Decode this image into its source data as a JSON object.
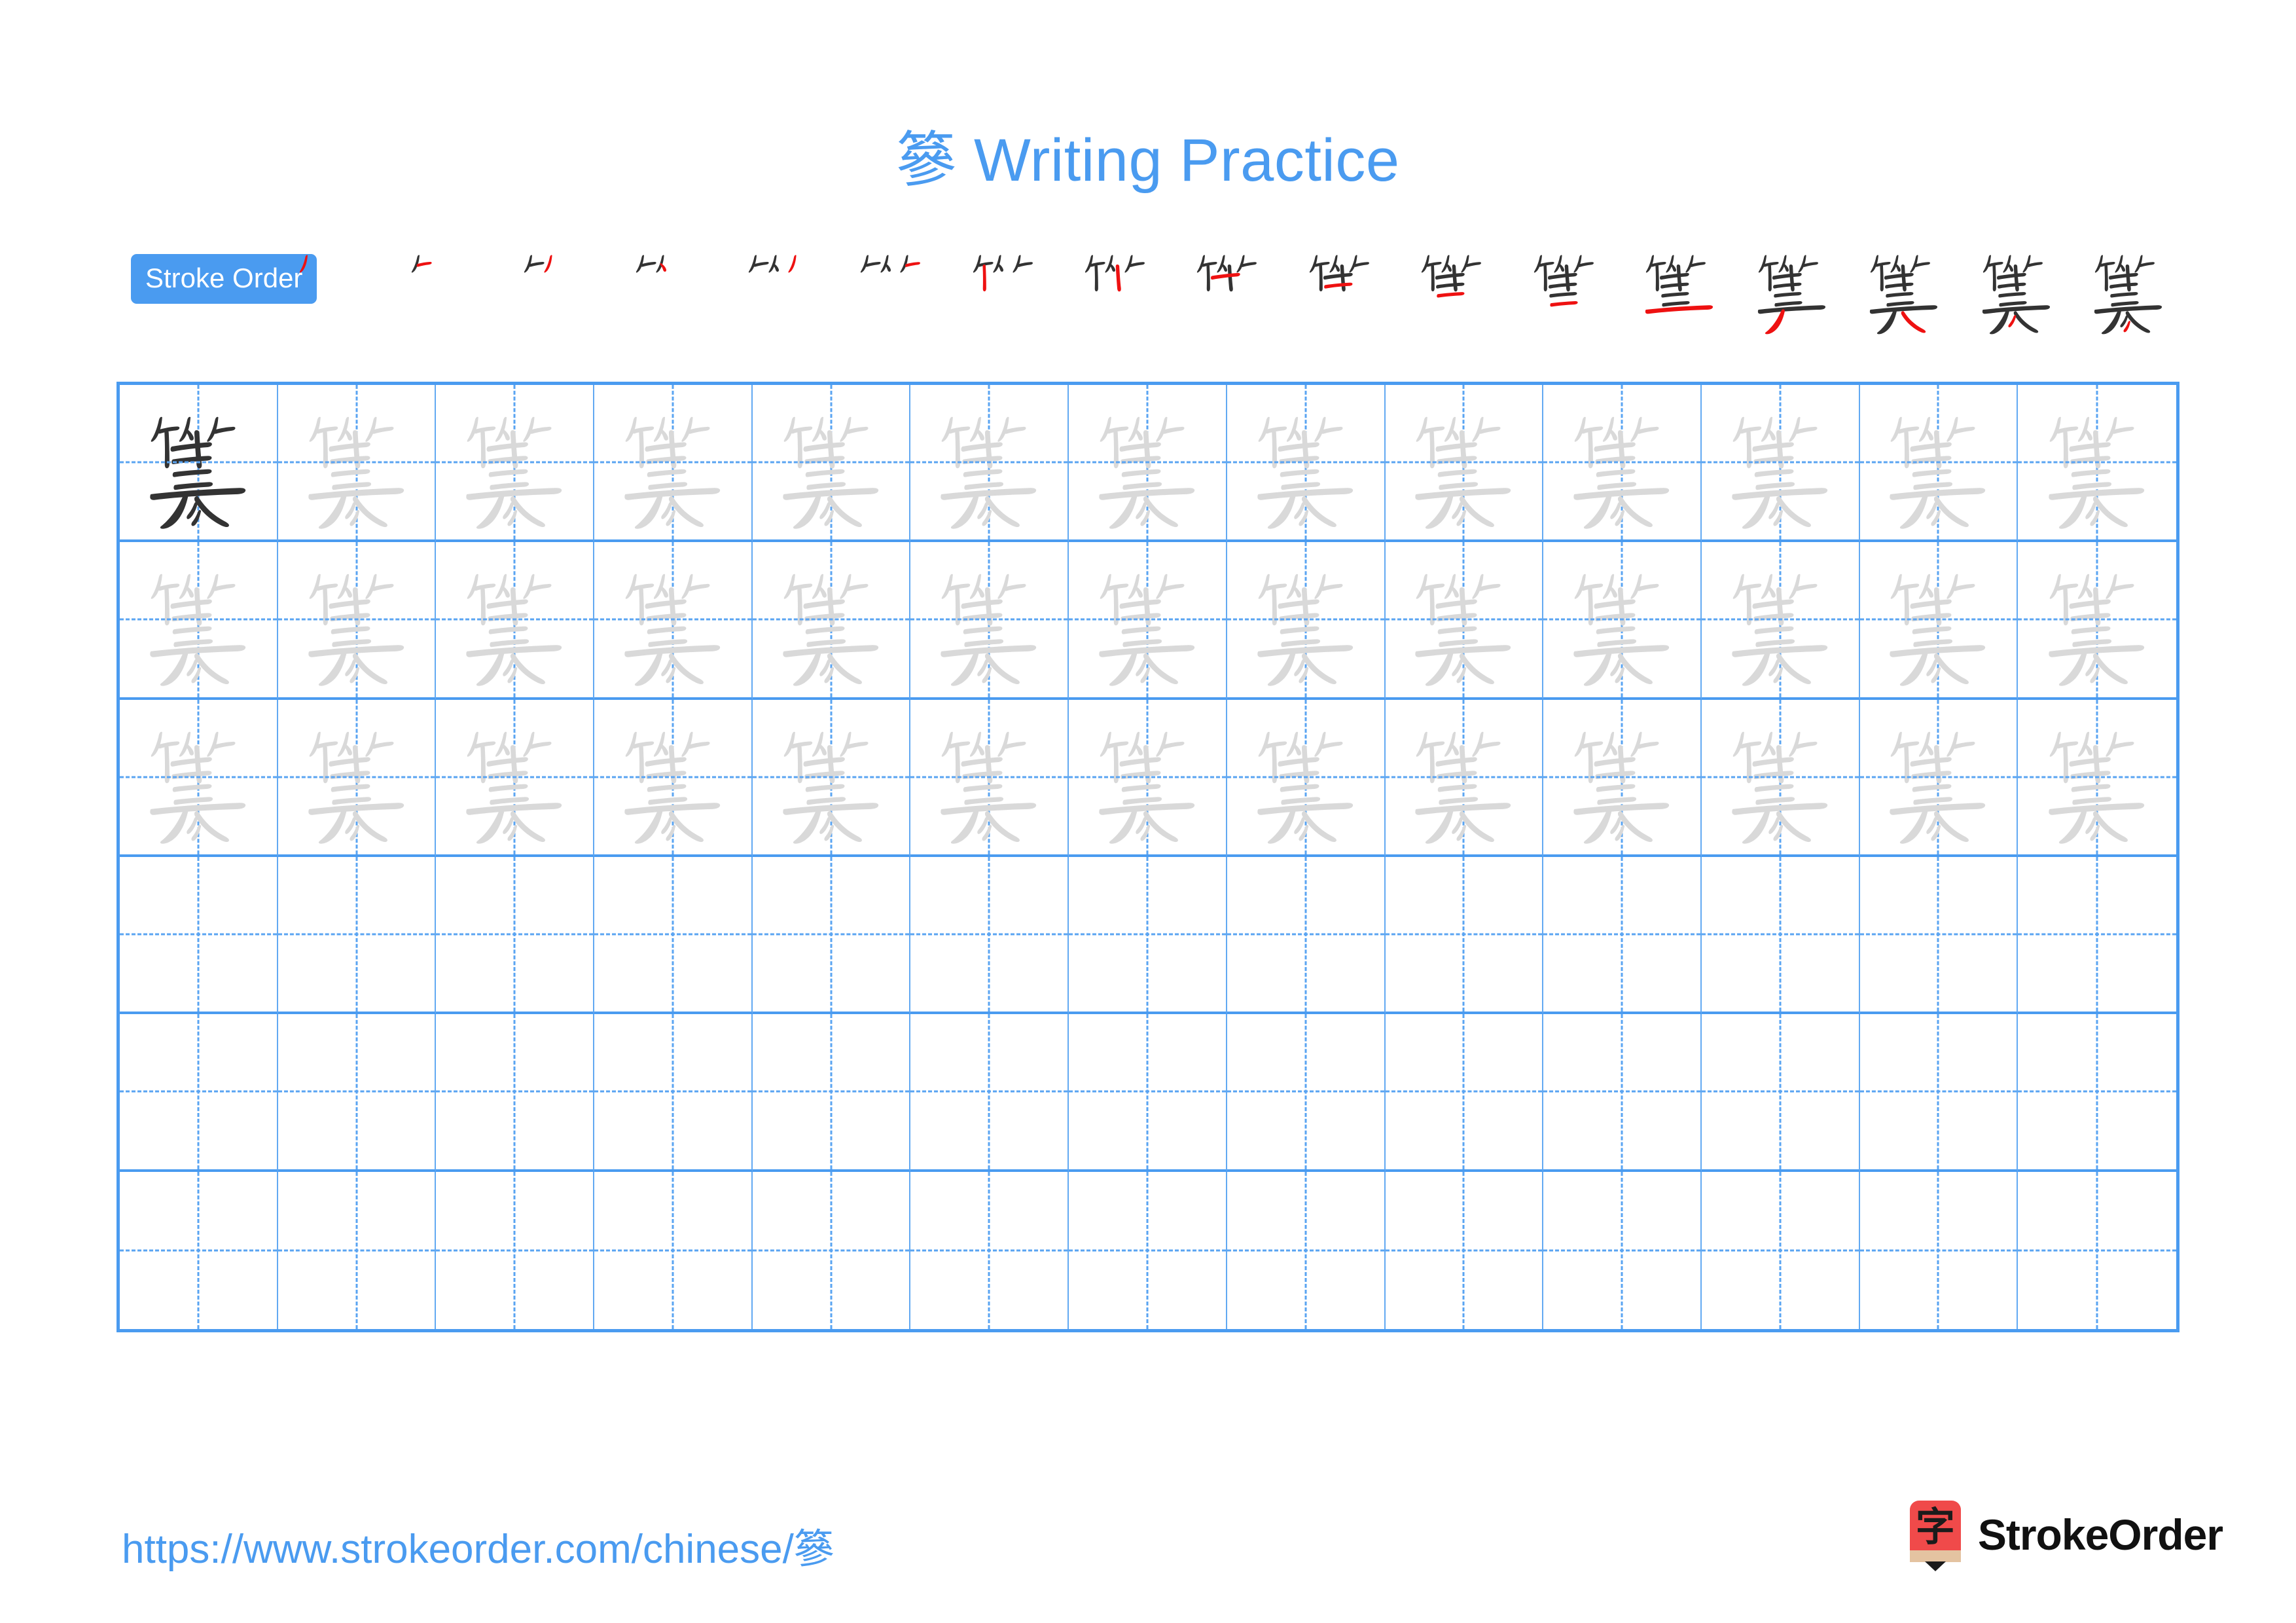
{
  "character": "篸",
  "header": {
    "title_character": "篸",
    "title_text": " Writing Practice",
    "title_full": "篸 Writing Practice",
    "title_color": "#4a9bf0"
  },
  "stroke_order": {
    "badge_label": "Stroke Order",
    "badge_bg": "#4a9bf0",
    "badge_text_color": "#ffffff",
    "done_stroke_color": "#333333",
    "current_stroke_color": "#ee1111",
    "total_strokes": 17,
    "steps": [
      {
        "index": 1,
        "strokes_drawn": 1
      },
      {
        "index": 2,
        "strokes_drawn": 2
      },
      {
        "index": 3,
        "strokes_drawn": 3
      },
      {
        "index": 4,
        "strokes_drawn": 4
      },
      {
        "index": 5,
        "strokes_drawn": 5
      },
      {
        "index": 6,
        "strokes_drawn": 6
      },
      {
        "index": 7,
        "strokes_drawn": 7
      },
      {
        "index": 8,
        "strokes_drawn": 8
      },
      {
        "index": 9,
        "strokes_drawn": 9
      },
      {
        "index": 10,
        "strokes_drawn": 10
      },
      {
        "index": 11,
        "strokes_drawn": 11
      },
      {
        "index": 12,
        "strokes_drawn": 12
      },
      {
        "index": 13,
        "strokes_drawn": 13
      },
      {
        "index": 14,
        "strokes_drawn": 14
      },
      {
        "index": 15,
        "strokes_drawn": 15
      },
      {
        "index": 16,
        "strokes_drawn": 16
      },
      {
        "index": 17,
        "strokes_drawn": 17
      }
    ]
  },
  "practice_grid": {
    "columns": 13,
    "rows": 6,
    "border_color": "#4a9bf0",
    "guide_color": "#5aa4f2",
    "dark_char_color": "#333333",
    "trace_char_color": "#d9d9d9",
    "cells": [
      [
        "dark",
        "trace",
        "trace",
        "trace",
        "trace",
        "trace",
        "trace",
        "trace",
        "trace",
        "trace",
        "trace",
        "trace",
        "trace"
      ],
      [
        "trace",
        "trace",
        "trace",
        "trace",
        "trace",
        "trace",
        "trace",
        "trace",
        "trace",
        "trace",
        "trace",
        "trace",
        "trace"
      ],
      [
        "trace",
        "trace",
        "trace",
        "trace",
        "trace",
        "trace",
        "trace",
        "trace",
        "trace",
        "trace",
        "trace",
        "trace",
        "trace"
      ],
      [
        "empty",
        "empty",
        "empty",
        "empty",
        "empty",
        "empty",
        "empty",
        "empty",
        "empty",
        "empty",
        "empty",
        "empty",
        "empty"
      ],
      [
        "empty",
        "empty",
        "empty",
        "empty",
        "empty",
        "empty",
        "empty",
        "empty",
        "empty",
        "empty",
        "empty",
        "empty",
        "empty"
      ],
      [
        "empty",
        "empty",
        "empty",
        "empty",
        "empty",
        "empty",
        "empty",
        "empty",
        "empty",
        "empty",
        "empty",
        "empty",
        "empty"
      ]
    ]
  },
  "footer": {
    "url": "https://www.strokeorder.com/chinese/篸",
    "url_color": "#4a9bf0",
    "logo_glyph": "字",
    "logo_text": "StrokeOrder",
    "logo_bg": "#f04a4a"
  }
}
